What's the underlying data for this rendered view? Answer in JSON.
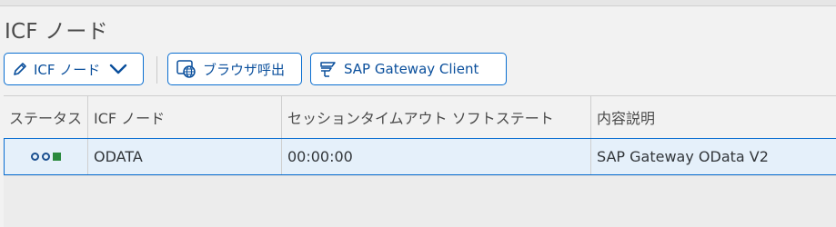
{
  "page": {
    "title": "ICF ノード"
  },
  "toolbar": {
    "icf_node_label": "ICF ノード",
    "browser_label": "ブラウザ呼出",
    "gateway_label": "SAP Gateway Client"
  },
  "table": {
    "headers": [
      "ステータス",
      "ICF ノード",
      "セッションタイムアウト ソフトステート",
      "内容説明"
    ],
    "rows": [
      {
        "status_icons": [
          "status-inactive-icon",
          "status-inactive-icon",
          "status-active-icon"
        ],
        "node": "ODATA",
        "timeout": "00:00:00",
        "description": "SAP Gateway OData V2"
      }
    ]
  },
  "colors": {
    "accent": "#0a6ed1",
    "selected_row": "#e5f0fa",
    "active_status": "#2b8a3e"
  }
}
